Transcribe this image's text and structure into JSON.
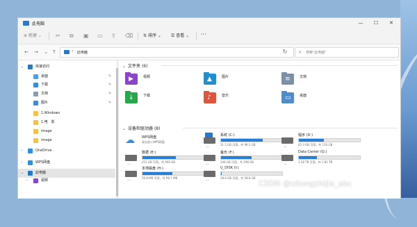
{
  "window": {
    "title": "此电脑",
    "controls": {
      "minimize": "—",
      "maximize": "☐",
      "close": "✕"
    }
  },
  "toolbar": {
    "new": "新建",
    "sort": "排序",
    "view": "查看",
    "more": "···"
  },
  "nav": {
    "back": "←",
    "forward": "→",
    "down": "⌄",
    "up": "↑"
  },
  "address": {
    "path": "此电脑",
    "separator": "›",
    "dropdown": "⌄",
    "refresh": "↻"
  },
  "search": {
    "placeholder": "搜索\"此电脑\"",
    "icon": "⌕"
  },
  "sidebar": {
    "items": [
      {
        "label": "快速访问",
        "icon": "star-icon",
        "chevron": "⌄",
        "color": "#2b78c4"
      },
      {
        "label": "桌面",
        "icon": "desktop-icon",
        "pin": "✎",
        "color": "#4aa0e6"
      },
      {
        "label": "下载",
        "icon": "download-icon",
        "pin": "✎",
        "color": "#2f8fe0"
      },
      {
        "label": "文档",
        "icon": "documents-icon",
        "pin": "✎",
        "color": "#8a9bb0"
      },
      {
        "label": "图片",
        "icon": "pictures-icon",
        "pin": "✎",
        "color": "#3b8ed4"
      },
      {
        "label": "1.Windows",
        "icon": "folder-icon",
        "color": "#f2c14e"
      },
      {
        "label": "1.电　影",
        "icon": "folder-icon",
        "color": "#f2c14e"
      },
      {
        "label": "image",
        "icon": "folder-icon",
        "color": "#f2c14e"
      },
      {
        "label": "image",
        "icon": "folder-icon",
        "color": "#f2c14e"
      },
      {
        "label": "OneDrive",
        "icon": "onedrive-icon",
        "chevron": "›",
        "color": "#2f8fe0"
      },
      {
        "label": "WPS网盘",
        "icon": "wps-cloud-icon",
        "chevron": "›",
        "color": "#2f8fe0"
      },
      {
        "label": "此电脑",
        "icon": "computer-icon",
        "chevron": "⌄",
        "color": "#2b78c4",
        "selected": true
      },
      {
        "label": "视频",
        "icon": "videos-icon",
        "chevron": "›",
        "color": "#8a44c8"
      }
    ]
  },
  "folders_section": {
    "title": "文件夹 (6)",
    "chevron": "⌄"
  },
  "folders": [
    {
      "label": "视频",
      "icon": "videos-folder-icon",
      "glyph": "▶",
      "color": "#8a44c8"
    },
    {
      "label": "图片",
      "icon": "pictures-folder-icon",
      "glyph": "▲",
      "color": "#1f8fd4"
    },
    {
      "label": "文档",
      "icon": "documents-folder-icon",
      "glyph": "≡",
      "color": "#7b8fa8"
    },
    {
      "label": "下载",
      "icon": "downloads-folder-icon",
      "glyph": "↓",
      "color": "#27a84a"
    },
    {
      "label": "音乐",
      "icon": "music-folder-icon",
      "glyph": "♪",
      "color": "#e0533d"
    },
    {
      "label": "桌面",
      "icon": "desktop-folder-icon",
      "glyph": "▭",
      "color": "#4f8cc9"
    }
  ],
  "drives_section": {
    "title": "设备和驱动器 (8)",
    "chevron": "⌄"
  },
  "wps": {
    "name": "WPS网盘",
    "subtitle": "双击进入WPS网盘"
  },
  "drives": [
    {
      "name": "系统 (C:)",
      "info": "31.5 GB 可用，共 98.3 GB",
      "used": 0.68,
      "windows": true
    },
    {
      "name": "程序 (D:)",
      "info": "65.3 GB 可用，共 110 GB",
      "used": 0.41
    },
    {
      "name": "数据 (E:)",
      "info": "215 GB 可用，共 469 GB",
      "used": 0.54
    },
    {
      "name": "备份 (F:)",
      "info": "148 GB 可用，共 298 GB",
      "used": 0.5
    },
    {
      "name": "Data Center (G:)",
      "info": "1.28 TB 可用，共 1.81 TB",
      "used": 0.29
    },
    {
      "name": "本地磁盘 (H:)",
      "info": "50.8 MB 可用，共 98.7 MB",
      "used": 0.49
    },
    {
      "name": "U_DISK (I:)",
      "info": "28.6 GB 可用，共 28.8 GB",
      "used": 0.01
    }
  ],
  "watermark": "CSDN @xitongzhijia_abc"
}
